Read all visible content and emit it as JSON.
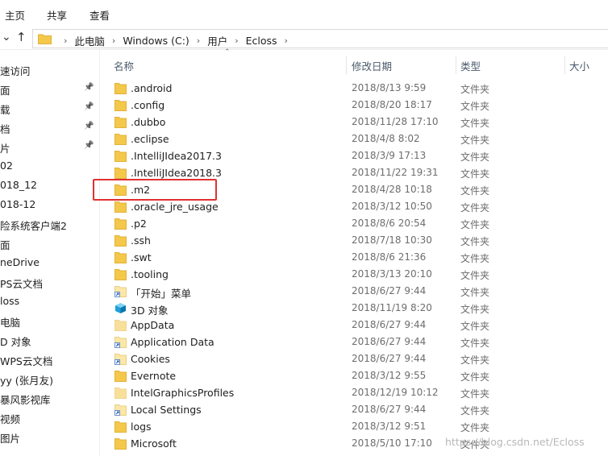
{
  "ribbon": {
    "tabs": [
      "主页",
      "共享",
      "查看"
    ]
  },
  "addressbar": {
    "crumbs": [
      "此电脑",
      "Windows (C:)",
      "用户",
      "Ecloss"
    ]
  },
  "navpane": {
    "items": [
      {
        "label": "速访问",
        "pinned": false
      },
      {
        "label": "面",
        "pinned": true
      },
      {
        "label": "载",
        "pinned": true
      },
      {
        "label": "档",
        "pinned": true
      },
      {
        "label": "片",
        "pinned": true
      },
      {
        "label": "02",
        "pinned": false
      },
      {
        "label": "018_12",
        "pinned": false
      },
      {
        "label": "018-12",
        "pinned": false
      },
      {
        "label": "险系统客户端2",
        "pinned": false
      },
      {
        "label": "面",
        "pinned": false
      },
      {
        "label": "neDrive",
        "pinned": false
      },
      {
        "label": "PS云文档",
        "pinned": false
      },
      {
        "label": "loss",
        "pinned": false
      },
      {
        "label": "电脑",
        "pinned": false
      },
      {
        "label": "D 对象",
        "pinned": false
      },
      {
        "label": "WPS云文档",
        "pinned": false
      },
      {
        "label": "yy (张月友)",
        "pinned": false
      },
      {
        "label": "暴风影视库",
        "pinned": false
      },
      {
        "label": "视频",
        "pinned": false
      },
      {
        "label": "图片",
        "pinned": false
      }
    ]
  },
  "columns": {
    "name": "名称",
    "date": "修改日期",
    "type": "类型",
    "size": "大小"
  },
  "files": [
    {
      "name": ".android",
      "date": "2018/8/13 9:59",
      "type": "文件夹",
      "icon": "folder-icon"
    },
    {
      "name": ".config",
      "date": "2018/8/20 18:17",
      "type": "文件夹",
      "icon": "folder-icon"
    },
    {
      "name": ".dubbo",
      "date": "2018/11/28 17:10",
      "type": "文件夹",
      "icon": "folder-icon"
    },
    {
      "name": ".eclipse",
      "date": "2018/4/8 8:02",
      "type": "文件夹",
      "icon": "folder-icon"
    },
    {
      "name": ".IntelliJIdea2017.3",
      "date": "2018/3/9 17:13",
      "type": "文件夹",
      "icon": "folder-icon"
    },
    {
      "name": ".IntelliJIdea2018.3",
      "date": "2018/11/22 19:31",
      "type": "文件夹",
      "icon": "folder-icon"
    },
    {
      "name": ".m2",
      "date": "2018/4/28 10:18",
      "type": "文件夹",
      "icon": "folder-icon"
    },
    {
      "name": ".oracle_jre_usage",
      "date": "2018/3/12 10:50",
      "type": "文件夹",
      "icon": "folder-icon"
    },
    {
      "name": ".p2",
      "date": "2018/8/6 20:54",
      "type": "文件夹",
      "icon": "folder-icon"
    },
    {
      "name": ".ssh",
      "date": "2018/7/18 10:30",
      "type": "文件夹",
      "icon": "folder-icon"
    },
    {
      "name": ".swt",
      "date": "2018/8/6 21:36",
      "type": "文件夹",
      "icon": "folder-icon"
    },
    {
      "name": ".tooling",
      "date": "2018/3/13 20:10",
      "type": "文件夹",
      "icon": "folder-icon"
    },
    {
      "name": "「开始」菜单",
      "date": "2018/6/27 9:44",
      "type": "文件夹",
      "icon": "shortcut-folder-icon"
    },
    {
      "name": "3D 对象",
      "date": "2018/11/19 8:20",
      "type": "文件夹",
      "icon": "3d-objects-icon"
    },
    {
      "name": "AppData",
      "date": "2018/6/27 9:44",
      "type": "文件夹",
      "icon": "hidden-folder-icon"
    },
    {
      "name": "Application Data",
      "date": "2018/6/27 9:44",
      "type": "文件夹",
      "icon": "shortcut-folder-icon"
    },
    {
      "name": "Cookies",
      "date": "2018/6/27 9:44",
      "type": "文件夹",
      "icon": "shortcut-folder-icon"
    },
    {
      "name": "Evernote",
      "date": "2018/3/12 9:55",
      "type": "文件夹",
      "icon": "folder-icon"
    },
    {
      "name": "IntelGraphicsProfiles",
      "date": "2018/12/19 10:12",
      "type": "文件夹",
      "icon": "hidden-folder-icon"
    },
    {
      "name": "Local Settings",
      "date": "2018/6/27 9:44",
      "type": "文件夹",
      "icon": "shortcut-folder-icon"
    },
    {
      "name": "logs",
      "date": "2018/3/12 9:51",
      "type": "文件夹",
      "icon": "folder-icon"
    },
    {
      "name": "Microsoft",
      "date": "2018/5/10 17:10",
      "type": "文件夹",
      "icon": "folder-icon"
    }
  ],
  "highlighted_file": ".m2",
  "watermark": "https://blog.csdn.net/Ecloss",
  "colors": {
    "folder": "#f4c84a",
    "folder_dark": "#e2b23a",
    "highlight": "#e03131",
    "text_muted": "#6d6d6d"
  }
}
